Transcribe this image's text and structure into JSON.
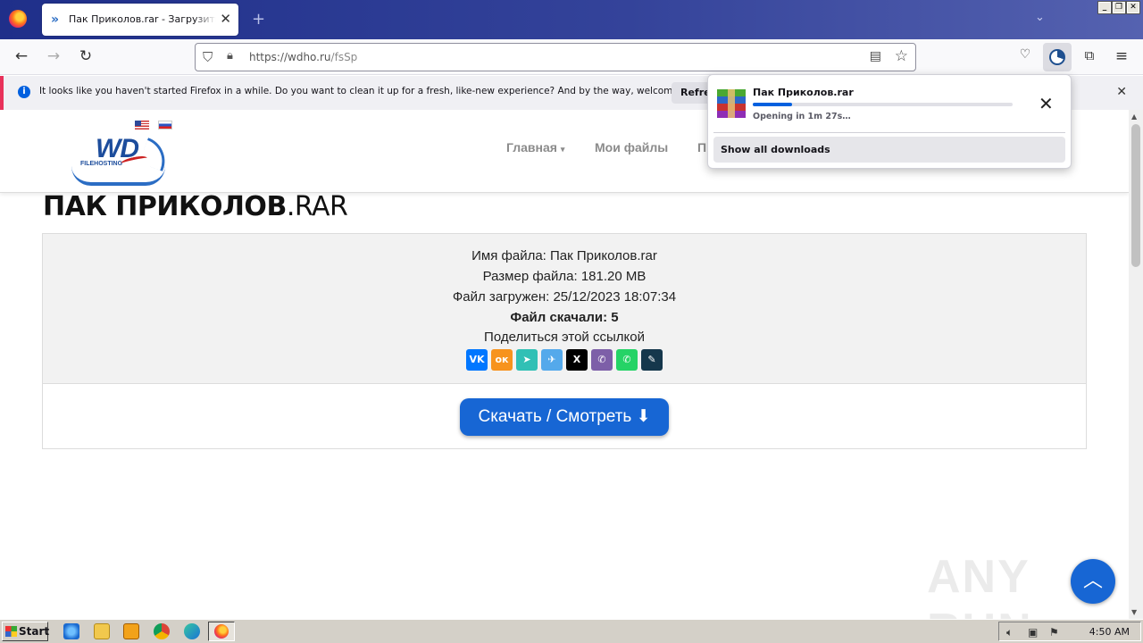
{
  "browser": {
    "tab_title": "Пак Приколов.rar - Загрузить файл",
    "url_domain": "https://wdho.ru",
    "url_path": "/fsSp"
  },
  "notification": {
    "text": "It looks like you haven't started Firefox in a while. Do you want to clean it up for a fresh, like-new experience? And by the way, welcome back!",
    "button": "Refresh Firefox"
  },
  "downloads": {
    "file_name": "Пак Приколов.rar",
    "status": "Opening in 1m 27s…",
    "progress": 0.15,
    "show_all": "Show all downloads"
  },
  "site": {
    "logo_text": "WD",
    "logo_sub": "FILEHOSTING",
    "menu": [
      "Главная",
      "Мои файлы",
      "П"
    ]
  },
  "page": {
    "title_main": "ПАК ПРИКОЛОВ",
    "title_ext": ".RAR",
    "file_name_line": "Имя файла: Пак Приколов.rar",
    "file_size_line": "Размер файла: 181.20 MB",
    "uploaded_line": "Файл загружен: 25/12/2023 18:07:34",
    "downloads_label": "Файл скачали: ",
    "downloads_count": "5",
    "share_label": "Поделиться этой ссылкой",
    "download_button": "Скачать / Смотреть"
  },
  "socials": [
    {
      "name": "vk",
      "glyph": "VK",
      "color": "#0077ff"
    },
    {
      "name": "odnoklassniki",
      "glyph": "ок",
      "color": "#f7931e"
    },
    {
      "name": "yandex-messenger",
      "glyph": "➤",
      "color": "#31c0b5"
    },
    {
      "name": "telegram",
      "glyph": "✈",
      "color": "#54a9eb"
    },
    {
      "name": "x",
      "glyph": "X",
      "color": "#000000"
    },
    {
      "name": "viber",
      "glyph": "✆",
      "color": "#7d5fa8"
    },
    {
      "name": "whatsapp",
      "glyph": "✆",
      "color": "#25d366"
    },
    {
      "name": "livejournal",
      "glyph": "✎",
      "color": "#15374c"
    }
  ],
  "watermark": "ANY RUN",
  "taskbar": {
    "start": "Start",
    "clock": "4:50 AM"
  },
  "colors": {
    "accent": "#1766d4",
    "notif_stripe": "#e8315a"
  }
}
